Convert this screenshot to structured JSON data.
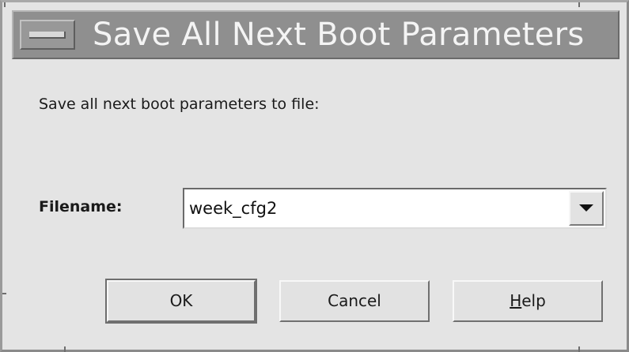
{
  "window": {
    "title": "Save All Next Boot Parameters"
  },
  "dialog": {
    "prompt": "Save all next boot parameters to file:",
    "filename_label": "Filename:",
    "filename_value": "week_cfg2"
  },
  "buttons": {
    "ok_label": "OK",
    "cancel_label": "Cancel",
    "help_mnemonic": "H",
    "help_rest": "elp"
  },
  "icons": {
    "window_menu": "window-menu-icon",
    "dropdown": "chevron-down-icon"
  },
  "colors": {
    "titlebar": "#8f8f8f",
    "title_text": "#f4f4f4",
    "dialog_bg": "#e4e4e4"
  }
}
